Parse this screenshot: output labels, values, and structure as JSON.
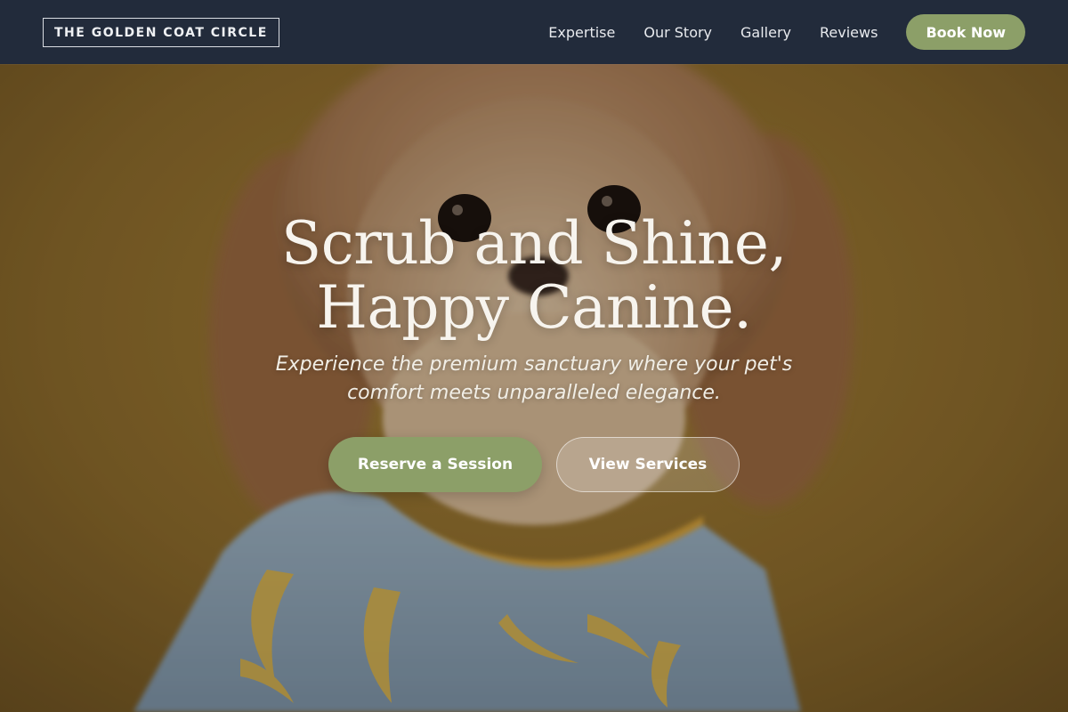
{
  "nav": {
    "brand": "THE GOLDEN COAT CIRCLE",
    "links": [
      "Expertise",
      "Our Story",
      "Gallery",
      "Reviews"
    ],
    "cta": "Book Now"
  },
  "hero": {
    "title_line1": "Scrub and Shine,",
    "title_line2": "Happy Canine.",
    "subtitle": "Experience the premium sanctuary where your pet's comfort meets unparalleled elegance.",
    "primary_button": "Reserve a Session",
    "secondary_button": "View Services",
    "background_image": "shih-tzu-puppy-in-banana-print-shirt"
  },
  "colors": {
    "nav_background": "#222b3b",
    "accent_green": "#8c9f68",
    "hero_background": "#8a6a2c"
  }
}
